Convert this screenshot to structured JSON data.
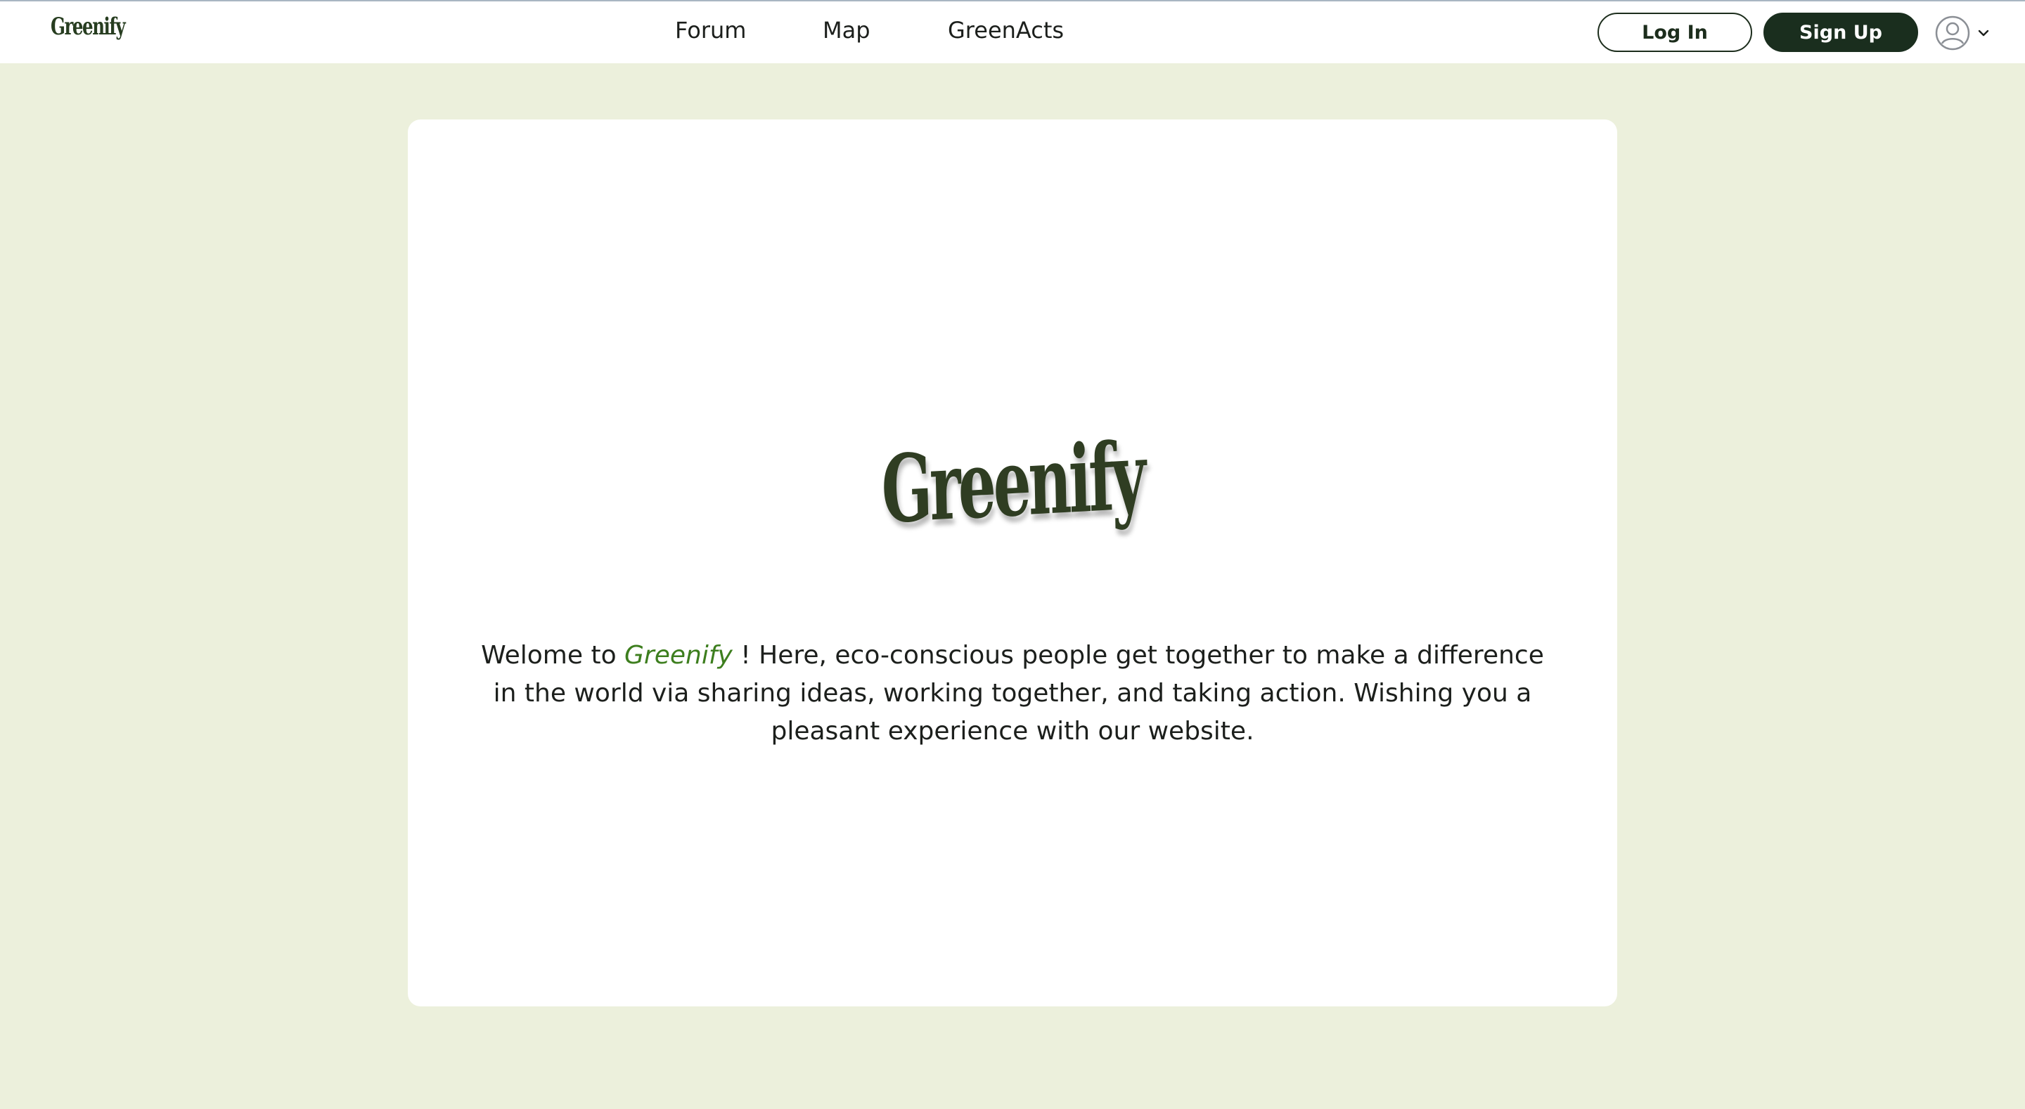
{
  "navbar": {
    "brand": "Greenify",
    "links": [
      {
        "label": "Forum"
      },
      {
        "label": "Map"
      },
      {
        "label": "GreenActs"
      }
    ],
    "login_label": "Log In",
    "signup_label": "Sign Up",
    "user_icon": "user-circle-icon",
    "dropdown_icon": "chevron-down-icon"
  },
  "hero": {
    "title": "Greenify",
    "intro_prefix": "Welome to ",
    "intro_brand": "Greenify",
    "intro_suffix": " ! Here, eco-conscious people get together to make a difference in the world via sharing ideas, working together, and taking action. Wishing you a pleasant experience with our website."
  },
  "colors": {
    "page_background": "#ecf0dc",
    "brand_dark": "#1a2e1e",
    "brand_inline": "#3d7e1e",
    "card_background": "#ffffff"
  }
}
